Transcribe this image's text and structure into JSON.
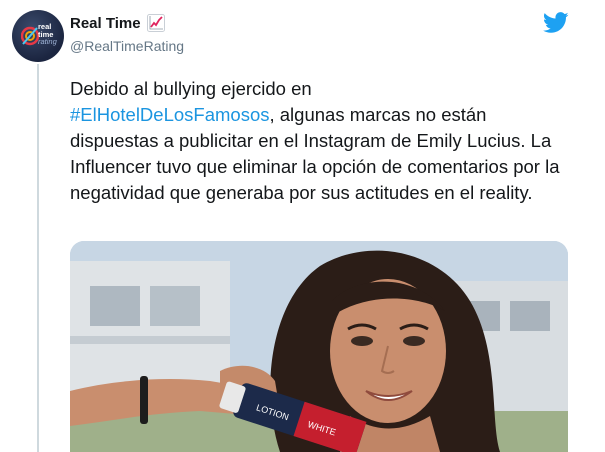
{
  "tweet": {
    "display_name": "Real Time",
    "handle": "@RealTimeRating",
    "text_line1": "Debido al bullying ejercido en",
    "hashtag": "#ElHotelDeLosFamosos",
    "text_rest": ", algunas marcas no están dispuestas a publicitar en el Instagram de Emily Lucius. La Influencer tuvo que eliminar la opción de comentarios por la negatividad que generaba por sus actitudes en el reality.",
    "hashtag_color": "#1b95e0",
    "text_color": "#14171a"
  },
  "avatar_logo": {
    "line1": "real",
    "line2": "time",
    "line3": "rating"
  },
  "icons": {
    "name_badge": "chart-increasing-icon",
    "brand": "twitter-bird-icon"
  },
  "media": {
    "bottle_label": "LOTION",
    "bottle_label2": "WHITE"
  }
}
